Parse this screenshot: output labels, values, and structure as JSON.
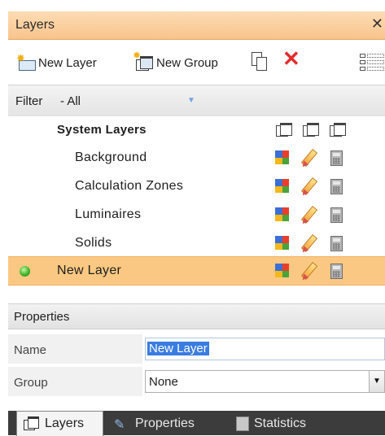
{
  "panel": {
    "title": "Layers",
    "close_glyph": "✕"
  },
  "toolbar": {
    "new_layer_label": "New Layer",
    "new_group_label": "New Group",
    "icons": [
      "new-layer-icon",
      "new-group-icon",
      "copy-icon",
      "delete-icon",
      "list-view-icon"
    ]
  },
  "filter": {
    "label": "Filter",
    "value": "- All"
  },
  "tree": {
    "group": {
      "label": "System Layers"
    },
    "children": [
      {
        "label": "Background"
      },
      {
        "label": "Calculation Zones"
      },
      {
        "label": "Luminaires"
      },
      {
        "label": "Solids"
      }
    ],
    "selected": {
      "label": "New Layer",
      "status_color": "#3fb52b"
    }
  },
  "properties": {
    "header": "Properties",
    "name_label": "Name",
    "name_value": "New Layer",
    "group_label": "Group",
    "group_value": "None"
  },
  "tabs": [
    {
      "label": "Layers",
      "active": true
    },
    {
      "label": "Properties",
      "active": false
    },
    {
      "label": "Statistics",
      "active": false
    }
  ],
  "colors": {
    "title_bar": "#f8c48c",
    "selection": "#fbc883",
    "text_selection": "#3a7ce1",
    "tab_bar": "#3c3c3c",
    "delete": "#e32b2b"
  }
}
